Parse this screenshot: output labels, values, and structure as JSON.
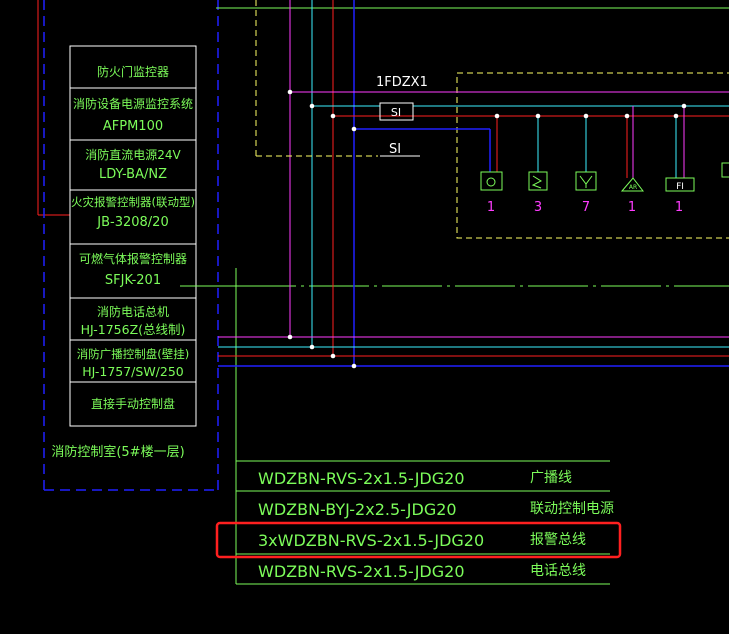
{
  "panel": {
    "items": [
      {
        "line1": "防火门监控器",
        "line2": ""
      },
      {
        "line1": "消防设备电源监控系统",
        "line2": "AFPM100"
      },
      {
        "line1": "消防直流电源24V",
        "line2": "LDY-BA/NZ"
      },
      {
        "line1": "火灾报警控制器(联动型)",
        "line2": "JB-3208/20"
      },
      {
        "line1": "可燃气体报警控制器",
        "line2": "SFJK-201"
      },
      {
        "line1": "消防电话总机",
        "line2": "HJ-1756Z(总线制)"
      },
      {
        "line1": "消防广播控制盘(壁挂)",
        "line2": "HJ-1757/SW/250"
      },
      {
        "line1": "直接手动控制盘",
        "line2": ""
      }
    ],
    "room_label": "消防控制室(5#楼一层)"
  },
  "distribution": {
    "box_label": "1FDZX1",
    "si_label": "SI",
    "s_label": "SI",
    "devices": [
      {
        "icon": "loudspeaker-icon",
        "count": "1"
      },
      {
        "icon": "input-module-icon",
        "count": "3"
      },
      {
        "icon": "smoke-detector-icon",
        "count": "7"
      },
      {
        "icon": "manual-alarm-icon",
        "count": "1"
      },
      {
        "icon": "fire-interface-icon",
        "count": "1"
      }
    ],
    "device_fi_label": "FI",
    "device_bell_label": "AR"
  },
  "legend": {
    "rows": [
      {
        "cable": "WDZBN-RVS-2x1.5-JDG20",
        "desc": "广播线"
      },
      {
        "cable": "WDZBN-BYJ-2x2.5-JDG20",
        "desc": "联动控制电源"
      },
      {
        "cable": "3xWDZBN-RVS-2x1.5-JDG20",
        "desc": "报警总线"
      },
      {
        "cable": "WDZBN-RVS-2x1.5-JDG20",
        "desc": "电话总线"
      }
    ],
    "highlight_row": 2
  },
  "colors": {
    "background": "#000000",
    "cad_green": "#7CFC5A",
    "line_magenta": "#ff3cff",
    "line_cyan": "#3cf0ff",
    "line_red": "#ff2020",
    "line_blue": "#2020ff",
    "dashed_yellow": "#ffff66",
    "highlight_red": "#ff2020"
  }
}
